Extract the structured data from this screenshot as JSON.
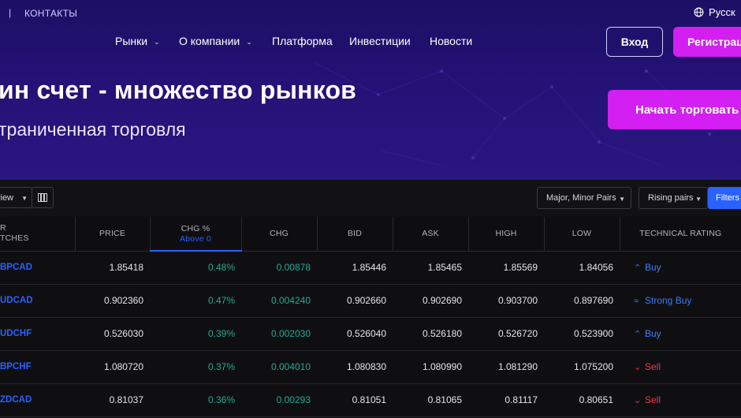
{
  "header": {
    "separator": "|",
    "contacts": "КОНТАКТЫ",
    "language": "Русск",
    "nav": [
      {
        "label": "Рынки",
        "dropdown": true
      },
      {
        "label": "О компании",
        "dropdown": true
      },
      {
        "label": "Платформа",
        "dropdown": false
      },
      {
        "label": "Инвестиции",
        "dropdown": false
      },
      {
        "label": "Новости",
        "dropdown": false
      }
    ],
    "login": "Вход",
    "register": "Регистрац"
  },
  "hero": {
    "title": "ин счет - множество рынков",
    "subtitle": "траниченная торговля",
    "cta": "Начать торговать"
  },
  "screener": {
    "view_label": "view",
    "filter_pairs": "Major, Minor Pairs",
    "filter_sort": "Rising pairs",
    "filters_button": "Filters",
    "columns": {
      "symbol_line1": "R",
      "symbol_line2": "TCHES",
      "price": "PRICE",
      "chg_pct": "CHG %",
      "chg_pct_sub": "Above 0",
      "chg": "CHG",
      "bid": "BID",
      "ask": "ASK",
      "high": "HIGH",
      "low": "LOW",
      "rating": "TECHNICAL RATING"
    },
    "rows": [
      {
        "symbol": "BPCAD",
        "price": "1.85418",
        "chg_pct": "0.48%",
        "chg": "0.00878",
        "bid": "1.85446",
        "ask": "1.85465",
        "high": "1.85569",
        "low": "1.84056",
        "rating": "Buy",
        "rating_type": "buy",
        "rating_icon": "⌃"
      },
      {
        "symbol": "UDCAD",
        "price": "0.902360",
        "chg_pct": "0.47%",
        "chg": "0.004240",
        "bid": "0.902660",
        "ask": "0.902690",
        "high": "0.903700",
        "low": "0.897690",
        "rating": "Strong Buy",
        "rating_type": "sbuy",
        "rating_icon": "≈"
      },
      {
        "symbol": "UDCHF",
        "price": "0.526030",
        "chg_pct": "0.39%",
        "chg": "0.002030",
        "bid": "0.526040",
        "ask": "0.526180",
        "high": "0.526720",
        "low": "0.523900",
        "rating": "Buy",
        "rating_type": "buy",
        "rating_icon": "⌃"
      },
      {
        "symbol": "BPCHF",
        "price": "1.080720",
        "chg_pct": "0.37%",
        "chg": "0.004010",
        "bid": "1.080830",
        "ask": "1.080990",
        "high": "1.081290",
        "low": "1.075200",
        "rating": "Sell",
        "rating_type": "sell",
        "rating_icon": "⌄"
      },
      {
        "symbol": "ZDCAD",
        "price": "0.81037",
        "chg_pct": "0.36%",
        "chg": "0.00293",
        "bid": "0.81051",
        "ask": "0.81065",
        "high": "0.81117",
        "low": "0.80651",
        "rating": "Sell",
        "rating_type": "sell",
        "rating_icon": "⌄"
      }
    ]
  },
  "colors": {
    "accent_magenta": "#d41ff2",
    "accent_blue": "#2962ff",
    "positive": "#22ab94",
    "negative": "#f23645",
    "hero_bg": "#241276"
  }
}
